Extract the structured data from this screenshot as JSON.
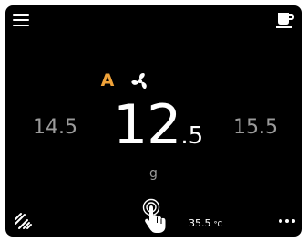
{
  "header": {
    "menu_icon": "hamburger-menu-icon",
    "cup_icon": "coffee-cup-icon"
  },
  "mode": {
    "letter": "A",
    "letter_color": "#f0a33a",
    "fan_icon": "fan-icon"
  },
  "grind": {
    "prev_value": "14.5",
    "current_int": "12",
    "current_dec": ".5",
    "next_value": "15.5",
    "unit": "g"
  },
  "footer": {
    "grind_icon": "grind-icon",
    "touch_icon": "touch-hand-icon",
    "temperature_value": "35.5",
    "temperature_unit": "°C",
    "more_icon": "more-dots-icon"
  },
  "colors": {
    "background": "#000000",
    "text_primary": "#ffffff",
    "text_secondary": "#9a9a9a",
    "accent": "#f0a33a"
  }
}
